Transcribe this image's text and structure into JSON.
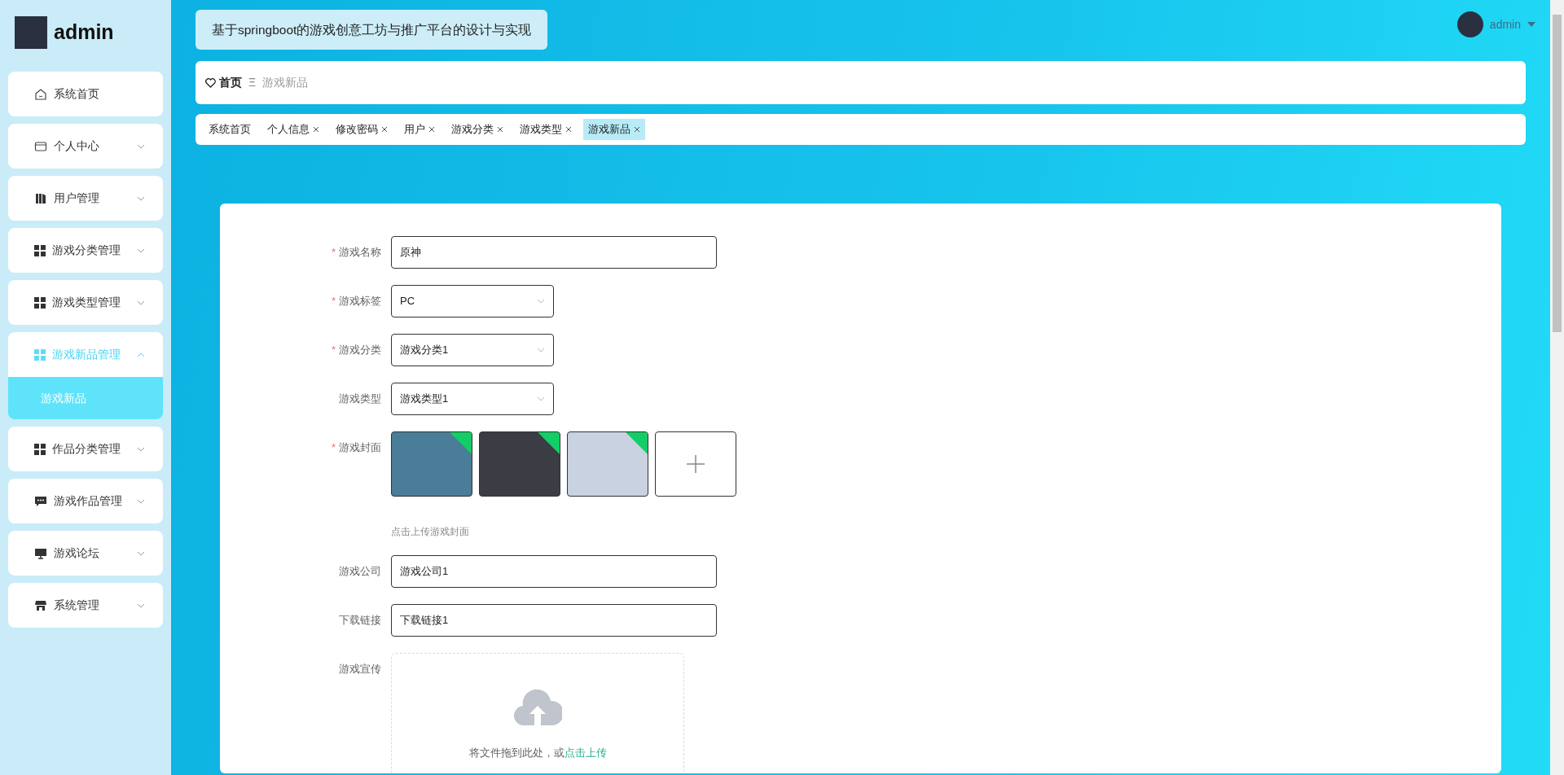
{
  "sidebar": {
    "user": "admin",
    "items": [
      {
        "label": "系统首页",
        "kind": "home",
        "expandable": false,
        "expanded": false
      },
      {
        "label": "个人中心",
        "kind": "card",
        "expandable": true,
        "expanded": false
      },
      {
        "label": "用户管理",
        "kind": "books",
        "expandable": true,
        "expanded": false
      },
      {
        "label": "游戏分类管理",
        "kind": "grid",
        "expandable": true,
        "expanded": false
      },
      {
        "label": "游戏类型管理",
        "kind": "grid",
        "expandable": true,
        "expanded": false
      },
      {
        "label": "游戏新品管理",
        "kind": "grid",
        "expandable": true,
        "expanded": true,
        "children": [
          {
            "label": "游戏新品",
            "selected": true
          }
        ]
      },
      {
        "label": "作品分类管理",
        "kind": "grid",
        "expandable": true,
        "expanded": false
      },
      {
        "label": "游戏作品管理",
        "kind": "chat",
        "expandable": true,
        "expanded": false
      },
      {
        "label": "游戏论坛",
        "kind": "monitor",
        "expandable": true,
        "expanded": false
      },
      {
        "label": "系统管理",
        "kind": "store",
        "expandable": true,
        "expanded": false
      }
    ]
  },
  "header": {
    "title": "基于springboot的游戏创意工坊与推广平台的设计与实现",
    "user": "admin"
  },
  "breadcrumb": {
    "home": "首页",
    "separator": "Ξ",
    "current": "游戏新品"
  },
  "tabs": [
    {
      "label": "系统首页",
      "closable": false,
      "selected": false
    },
    {
      "label": "个人信息",
      "closable": true,
      "selected": false
    },
    {
      "label": "修改密码",
      "closable": true,
      "selected": false
    },
    {
      "label": "用户",
      "closable": true,
      "selected": false
    },
    {
      "label": "游戏分类",
      "closable": true,
      "selected": false
    },
    {
      "label": "游戏类型",
      "closable": true,
      "selected": false
    },
    {
      "label": "游戏新品",
      "closable": true,
      "selected": true
    }
  ],
  "form": {
    "required_mark": "*",
    "fields": [
      {
        "kind": "text",
        "label": "游戏名称",
        "required": true,
        "value": "原神"
      },
      {
        "kind": "select",
        "label": "游戏标签",
        "required": true,
        "value": "PC"
      },
      {
        "kind": "select",
        "label": "游戏分类",
        "required": true,
        "value": "游戏分类1"
      },
      {
        "kind": "select",
        "label": "游戏类型",
        "required": false,
        "value": "游戏类型1"
      },
      {
        "kind": "images",
        "label": "游戏封面",
        "required": true,
        "images": [
          {
            "uploaded": true,
            "color": "#4a7d98"
          },
          {
            "uploaded": true,
            "color": "#3c3c44"
          },
          {
            "uploaded": true,
            "color": "#c8d2e0"
          }
        ],
        "hint": "点击上传游戏封面"
      },
      {
        "kind": "text",
        "label": "游戏公司",
        "required": false,
        "value": "游戏公司1"
      },
      {
        "kind": "text",
        "label": "下载链接",
        "required": false,
        "value": "下载链接1"
      },
      {
        "kind": "upload",
        "label": "游戏宣传",
        "required": false,
        "text": "将文件拖到此处，或",
        "link": "点击上传"
      }
    ]
  }
}
